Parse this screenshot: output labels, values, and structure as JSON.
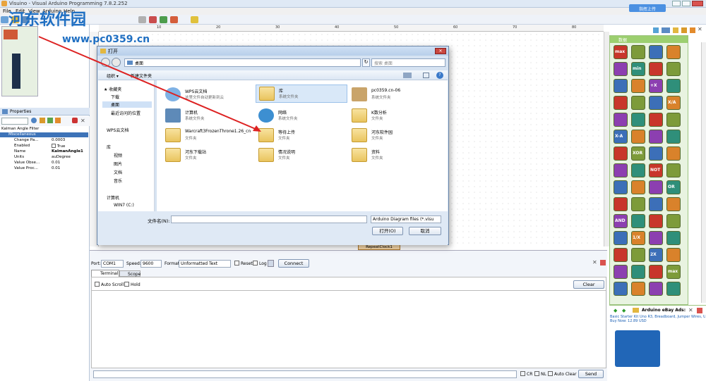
{
  "app": {
    "title": "Visuino - Visual Arduino Programming 7.8.2.252",
    "share_label": "指挥上传"
  },
  "menu": [
    "File",
    "Edit",
    "View",
    "Arduino",
    "Help"
  ],
  "ruler_marks": [
    "10",
    "20",
    "30",
    "40",
    "50",
    "60",
    "70",
    "80"
  ],
  "properties": {
    "tab": "Properties",
    "header": "Kalman Angle Filter",
    "group": "Miscellaneous",
    "rows": [
      {
        "name": "Change Pa...",
        "value": "0.0003"
      },
      {
        "name": "Enabled",
        "value": "True"
      },
      {
        "name": "Name",
        "value": "KalmanAngle1"
      },
      {
        "name": "Units",
        "value": "auDegree"
      },
      {
        "name": "Value Obse...",
        "value": "0.01"
      },
      {
        "name": "Value Proc...",
        "value": "0.01"
      }
    ]
  },
  "palette": {
    "title": "数据"
  },
  "dialog": {
    "title": "打开",
    "path": "桌面",
    "search_placeholder": "搜索 桌面",
    "organize": "组织 ▾",
    "new_folder": "新建文件夹",
    "nav": {
      "favorites": "收藏夹",
      "downloads": "下载",
      "desktop": "桌面",
      "recent": "最近访问的位置",
      "wps": "WPS云文档",
      "libraries": "库",
      "videos": "视频",
      "pictures": "图片",
      "documents": "文档",
      "music": "音乐",
      "computer": "计算机",
      "drive": "WIN7 (C:)"
    },
    "files": [
      {
        "name": "WPS云文档",
        "desc": "这里文件自动更新到云"
      },
      {
        "name": "库",
        "desc": "系统文件夹"
      },
      {
        "name": "pc0359.cn-06",
        "desc": "系统文件夹"
      },
      {
        "name": "计算机",
        "desc": "系统文件夹"
      },
      {
        "name": "网络",
        "desc": "系统文件夹"
      },
      {
        "name": "K数分析",
        "desc": "文件夹"
      },
      {
        "name": "Warcraft3FrozenThrone1.26_cn",
        "desc": "文件夹"
      },
      {
        "name": "等待上传",
        "desc": "文件夹"
      },
      {
        "name": "河东软件园",
        "desc": "文件夹"
      },
      {
        "name": "河东下载站",
        "desc": "文件夹"
      },
      {
        "name": "情况说明",
        "desc": "文件夹"
      },
      {
        "name": "资料",
        "desc": "文件夹"
      }
    ],
    "filename_label": "文件名(N):",
    "filetype": "Arduino Diagram files (*.visu",
    "open_button": "打开(O)",
    "cancel_button": "取消"
  },
  "serial": {
    "port_label": "Port:",
    "port_value": "COM1",
    "speed_label": "Speed:",
    "speed_value": "9600",
    "format_label": "Format:",
    "format_value": "Unformatted Text",
    "reset_label": "Reset",
    "log_label": "Log",
    "connect_label": "Connect",
    "tab_terminal": "Terminal",
    "tab_scope": "Scope",
    "autoscroll_label": "Auto Scroll",
    "hold_label": "Hold",
    "clear_label": "Clear",
    "cr_label": "CR",
    "nl_label": "NL",
    "autoclear_label": "Auto Clear",
    "send_label": "Send",
    "canvas_node": "RepeatClock1"
  },
  "ads": {
    "title": "Arduino eBay Ads:",
    "text": "Basic Starter Kit Uno R3, Breadboard, Jumper Wires, U",
    "price": "Buy Now: 12.89 USD"
  },
  "watermark": {
    "line1": "河东软件园",
    "line2": "www.pc0359.cn"
  },
  "palette_labels": [
    "max",
    "min",
    "+X",
    "X/A",
    "X-A",
    "XOR",
    "NOT",
    "OR",
    "AND",
    "1/X",
    "2X"
  ]
}
